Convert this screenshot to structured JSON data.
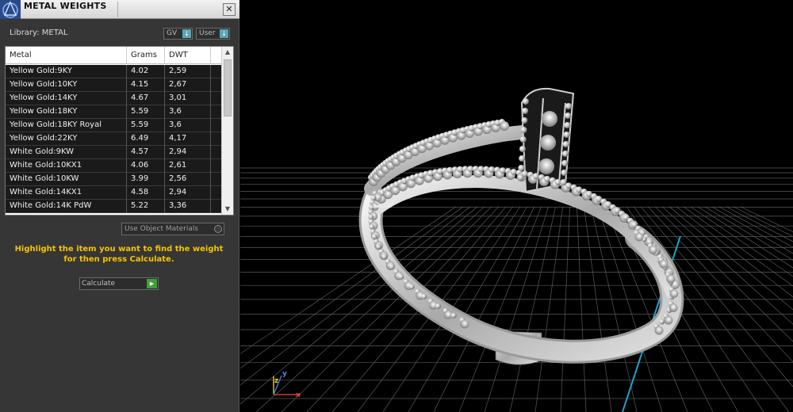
{
  "panel": {
    "title": "METAL WEIGHTS",
    "close_symbol": "✕",
    "library_label": "Library: METAL",
    "gv_label": "GV",
    "user_label": "User",
    "dropdown_arrow": "↓"
  },
  "table": {
    "headers": [
      "Metal",
      "Grams",
      "DWT"
    ],
    "rows": [
      {
        "metal": "Yellow Gold:9KY",
        "grams": "4.02",
        "dwt": "2,59"
      },
      {
        "metal": "Yellow Gold:10KY",
        "grams": "4.15",
        "dwt": "2,67"
      },
      {
        "metal": "Yellow Gold:14KY",
        "grams": "4.67",
        "dwt": "3,01"
      },
      {
        "metal": "Yellow Gold:18KY",
        "grams": "5.59",
        "dwt": "3,6"
      },
      {
        "metal": "Yellow Gold:18KY Royal",
        "grams": "5.59",
        "dwt": "3,6"
      },
      {
        "metal": "Yellow Gold:22KY",
        "grams": "6.49",
        "dwt": "4,17"
      },
      {
        "metal": "White Gold:9KW",
        "grams": "4.57",
        "dwt": "2,94"
      },
      {
        "metal": "White Gold:10KX1",
        "grams": "4.06",
        "dwt": "2,61"
      },
      {
        "metal": "White Gold:10KW",
        "grams": "3.99",
        "dwt": "2,56"
      },
      {
        "metal": "White Gold:14KX1",
        "grams": "4.58",
        "dwt": "2,94"
      },
      {
        "metal": "White Gold:14K PdW",
        "grams": "5.22",
        "dwt": "3,36"
      }
    ]
  },
  "use_object_materials": "Use Object Materials",
  "hint_text": "Highlight the item you want to find the weight for then press Calculate.",
  "calculate": {
    "label": "Calculate",
    "arrow": "▶"
  },
  "axis": {
    "y": "y",
    "z": "z",
    "x": "x"
  },
  "colors": {
    "hint": "#f5c400",
    "accent_button": "#5aa6b8",
    "go_button": "#3ea036",
    "grid": "#5a5a5a",
    "axis_line": "#1aa6c8"
  }
}
